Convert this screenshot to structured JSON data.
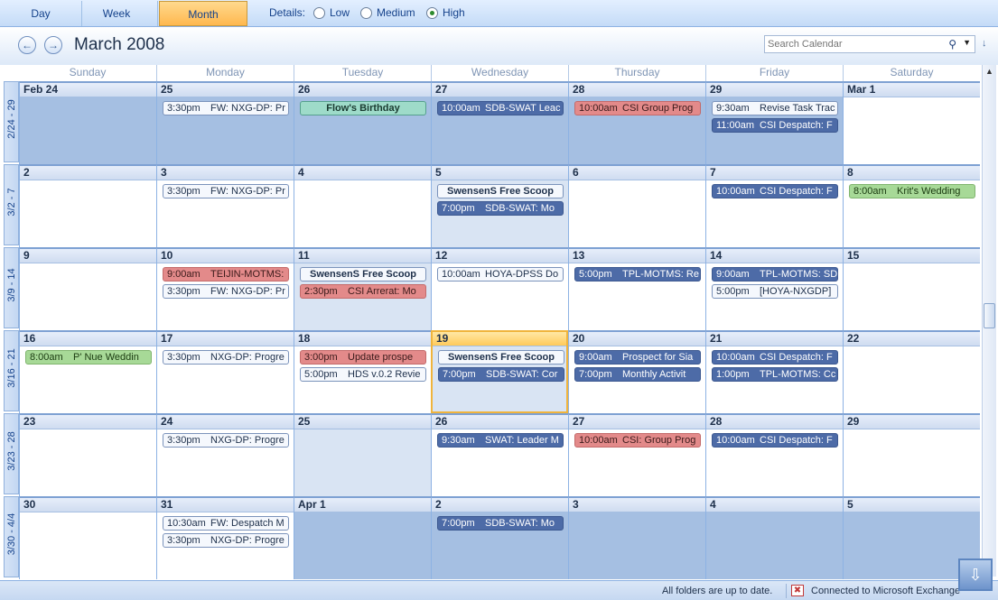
{
  "views": {
    "day": "Day",
    "week": "Week",
    "month": "Month"
  },
  "details": {
    "label": "Details:",
    "low": "Low",
    "medium": "Medium",
    "high": "High"
  },
  "header": {
    "title": "March 2008",
    "prev_icon": "arrow-left-icon",
    "next_icon": "arrow-right-icon"
  },
  "search": {
    "placeholder": "Search Calendar",
    "icon": "search-icon"
  },
  "days": [
    "Sunday",
    "Monday",
    "Tuesday",
    "Wednesday",
    "Thursday",
    "Friday",
    "Saturday"
  ],
  "weeks": [
    {
      "label": "2/24 - 29",
      "dates": [
        "Feb 24",
        "25",
        "26",
        "27",
        "28",
        "29",
        "Mar 1"
      ],
      "events": [
        [],
        [
          {
            "time": "3:30pm",
            "title": "FW: NXG-DP: Pr",
            "style": "white"
          }
        ],
        [
          {
            "time": "",
            "title": "Flow's Birthday",
            "style": "teal center"
          }
        ],
        [
          {
            "time": "10:00am",
            "title": "SDB-SWAT Leac",
            "style": "navy"
          }
        ],
        [
          {
            "time": "10:00am",
            "title": "CSI Group Prog",
            "style": "red"
          }
        ],
        [
          {
            "time": "9:30am",
            "title": "Revise Task Trac",
            "style": "white"
          },
          {
            "time": "11:00am",
            "title": "CSI Despatch: F",
            "style": "navy"
          }
        ],
        []
      ]
    },
    {
      "label": "3/2 - 7",
      "dates": [
        "2",
        "3",
        "4",
        "5",
        "6",
        "7",
        "8"
      ],
      "events": [
        [],
        [
          {
            "time": "3:30pm",
            "title": "FW: NXG-DP: Pr",
            "style": "white"
          }
        ],
        [],
        [
          {
            "time": "",
            "title": "SwensenS Free Scoop",
            "style": "white center"
          },
          {
            "time": "7:00pm",
            "title": "SDB-SWAT: Mo",
            "style": "navy"
          }
        ],
        [],
        [
          {
            "time": "10:00am",
            "title": "CSI Despatch: F",
            "style": "navy"
          }
        ],
        [
          {
            "time": "8:00am",
            "title": "Krit's Wedding",
            "style": "green"
          }
        ]
      ]
    },
    {
      "label": "3/9 - 14",
      "dates": [
        "9",
        "10",
        "11",
        "12",
        "13",
        "14",
        "15"
      ],
      "events": [
        [],
        [
          {
            "time": "9:00am",
            "title": "TEIJIN-MOTMS:",
            "style": "red"
          },
          {
            "time": "3:30pm",
            "title": "FW: NXG-DP: Pr",
            "style": "white"
          }
        ],
        [
          {
            "time": "",
            "title": "SwensenS Free Scoop",
            "style": "white center"
          },
          {
            "time": "2:30pm",
            "title": "CSI Arrerat: Mo",
            "style": "red"
          }
        ],
        [
          {
            "time": "10:00am",
            "title": "HOYA-DPSS Do",
            "style": "white"
          }
        ],
        [
          {
            "time": "5:00pm",
            "title": "TPL-MOTMS: Re",
            "style": "navy"
          }
        ],
        [
          {
            "time": "9:00am",
            "title": "TPL-MOTMS: SD",
            "style": "navy"
          },
          {
            "time": "5:00pm",
            "title": "[HOYA-NXGDP]",
            "style": "white"
          }
        ],
        []
      ]
    },
    {
      "label": "3/16 - 21",
      "dates": [
        "16",
        "17",
        "18",
        "19",
        "20",
        "21",
        "22"
      ],
      "events": [
        [
          {
            "time": "8:00am",
            "title": "P' Nue Weddin",
            "style": "green"
          }
        ],
        [
          {
            "time": "3:30pm",
            "title": "NXG-DP: Progre",
            "style": "white"
          }
        ],
        [
          {
            "time": "3:00pm",
            "title": "Update prospe",
            "style": "red"
          },
          {
            "time": "5:00pm",
            "title": "HDS v.0.2 Revie",
            "style": "white"
          }
        ],
        [
          {
            "time": "",
            "title": "SwensenS Free Scoop",
            "style": "white center"
          },
          {
            "time": "7:00pm",
            "title": "SDB-SWAT: Cor",
            "style": "navy"
          }
        ],
        [
          {
            "time": "9:00am",
            "title": "Prospect for Sia",
            "style": "navy"
          },
          {
            "time": "7:00pm",
            "title": "Monthly Activit",
            "style": "navy"
          }
        ],
        [
          {
            "time": "10:00am",
            "title": "CSI Despatch: F",
            "style": "navy"
          },
          {
            "time": "1:00pm",
            "title": "TPL-MOTMS: Cc",
            "style": "navy"
          }
        ],
        []
      ]
    },
    {
      "label": "3/23 - 28",
      "dates": [
        "23",
        "24",
        "25",
        "26",
        "27",
        "28",
        "29"
      ],
      "events": [
        [],
        [
          {
            "time": "3:30pm",
            "title": "NXG-DP: Progre",
            "style": "white"
          }
        ],
        [],
        [
          {
            "time": "9:30am",
            "title": "SWAT: Leader M",
            "style": "navy"
          }
        ],
        [
          {
            "time": "10:00am",
            "title": "CSI: Group Prog",
            "style": "red"
          }
        ],
        [
          {
            "time": "10:00am",
            "title": "CSI Despatch: F",
            "style": "navy"
          }
        ],
        []
      ]
    },
    {
      "label": "3/30 - 4/4",
      "dates": [
        "30",
        "31",
        "Apr 1",
        "2",
        "3",
        "4",
        "5"
      ],
      "events": [
        [],
        [
          {
            "time": "10:30am",
            "title": "FW: Despatch M",
            "style": "white"
          },
          {
            "time": "3:30pm",
            "title": "NXG-DP: Progre",
            "style": "white"
          }
        ],
        [],
        [
          {
            "time": "7:00pm",
            "title": "SDB-SWAT: Mo",
            "style": "navy"
          }
        ],
        [],
        [],
        []
      ]
    }
  ],
  "status": {
    "sync": "All folders are up to date.",
    "connection": "Connected to Microsoft Exchange"
  }
}
